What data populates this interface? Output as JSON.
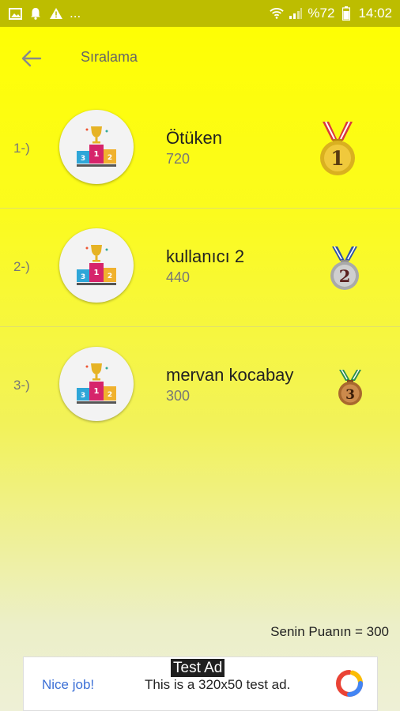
{
  "status_bar": {
    "battery": "%72",
    "time": "14:02",
    "left_icons": [
      "image-icon",
      "bell-icon",
      "warning-icon"
    ],
    "overflow": "...",
    "bg_color": "#bdbd00"
  },
  "app_bar": {
    "title": "Sıralama",
    "back_icon": "arrow-left-icon"
  },
  "leaderboard": [
    {
      "rank": "1-)",
      "name": "Ötüken",
      "score": "720",
      "medal": "1",
      "medal_type": "gold"
    },
    {
      "rank": "2-)",
      "name": "kullanıcı 2",
      "score": "440",
      "medal": "2",
      "medal_type": "silver"
    },
    {
      "rank": "3-)",
      "name": "mervan kocabay",
      "score": "300",
      "medal": "3",
      "medal_type": "bronze"
    }
  ],
  "my_score": "Senin Puanın = 300",
  "ad": {
    "tag": "Test Ad",
    "cta": "Nice job!",
    "text": "This is a 320x50 test ad."
  },
  "colors": {
    "background_top": "#ffff00",
    "background_bottom": "#eef0d6",
    "gold": "#d9b020",
    "silver": "#b8b8b8",
    "bronze": "#b0743c"
  }
}
